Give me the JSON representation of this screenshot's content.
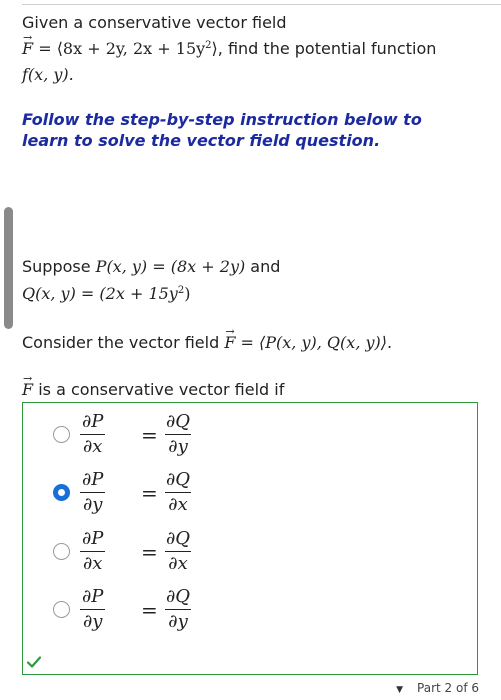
{
  "question": {
    "line1": "Given a conservative vector field",
    "field_expr": " = ⟨8x + 2y, 2x + 15y",
    "field_sup": "2",
    "field_close": "⟩",
    "line2_text": ", find the potential function",
    "func": "f(x, y).",
    "vector_symbol": "F"
  },
  "instruction": "Follow the step-by-step instruction below to learn to solve the vector field question.",
  "step": {
    "suppose_label": "Suppose ",
    "P_expr": "P(x, y) = (8x + 2y)",
    "and_label": " and",
    "Q_expr": "Q(x, y) = (2x + 15y",
    "Q_sup": "2",
    "Q_close": ")",
    "consider_label": "Consider the vector field ",
    "consider_expr": " = ⟨P(x, y), Q(x, y)⟩.",
    "conservative_label": " is a conservative vector field if"
  },
  "options": [
    {
      "lnum": "∂P",
      "lden": "∂x",
      "rnum": "∂Q",
      "rden": "∂y",
      "selected": false
    },
    {
      "lnum": "∂P",
      "lden": "∂y",
      "rnum": "∂Q",
      "rden": "∂x",
      "selected": true
    },
    {
      "lnum": "∂P",
      "lden": "∂x",
      "rnum": "∂Q",
      "rden": "∂x",
      "selected": false
    },
    {
      "lnum": "∂P",
      "lden": "∂y",
      "rnum": "∂Q",
      "rden": "∂y",
      "selected": false
    }
  ],
  "equals_sign": "=",
  "colors": {
    "accent": "#1a6fd6",
    "correct": "#2c9a3c",
    "instruction": "#1c2aa0"
  },
  "footer": {
    "part": "Part 2 of 6",
    "icon": "triangle-down-icon"
  }
}
